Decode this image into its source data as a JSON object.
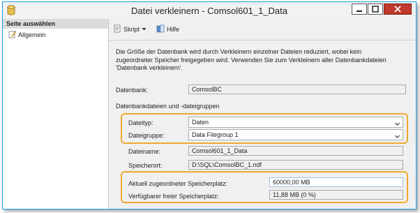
{
  "window": {
    "title": "Datei verkleinern - Comsol601_1_Data"
  },
  "sidebar": {
    "header": "Seite auswählen",
    "items": [
      {
        "label": "Allgemein"
      }
    ]
  },
  "toolbar": {
    "script_label": "Skript",
    "help_label": "Hilfe"
  },
  "description": "Die Größe der Datenbank wird durch Verkleinern einzelner Dateien reduziert, wobei kein zugeordneter Speicher freigegeben wird. Verwenden Sie zum Verkleinern aller Datenbankdateien 'Datenbank verkleinern'.",
  "database": {
    "label": "Datenbank:",
    "value": "ComsolBC"
  },
  "files_section": {
    "label": "Datenbankdateien und -dateigruppen"
  },
  "file_type": {
    "label": "Dateityp:",
    "value": "Daten"
  },
  "file_group": {
    "label": "Dateigruppe:",
    "value": "Data Filegroup 1"
  },
  "file_name": {
    "label": "Dateiname:",
    "value": "Comsol601_1_Data"
  },
  "location": {
    "label": "Speicherort:",
    "value": "D:\\SQL\\ComsolBC_1.ndf"
  },
  "allocated": {
    "label": "Aktuell zugeordneter Speicherplatz:",
    "value": "60000,00 MB"
  },
  "free": {
    "label": "Verfügbarer freier Speicherplatz:",
    "value": "11,88 MB (0 %)"
  },
  "colors": {
    "accent": "#1c9de8",
    "highlight": "#f0a830"
  }
}
